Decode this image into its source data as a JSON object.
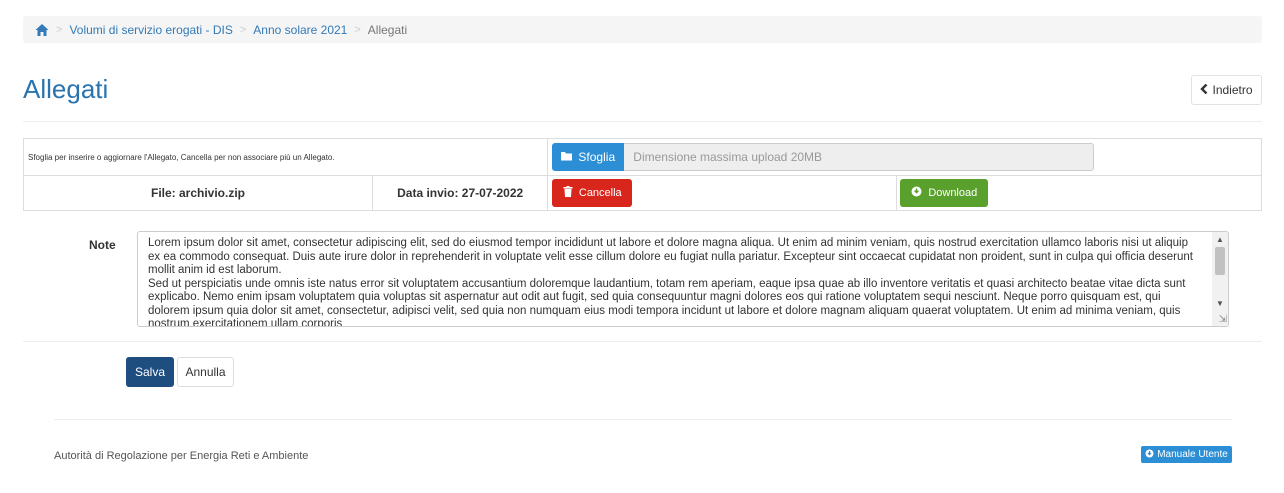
{
  "breadcrumb": {
    "home_icon": "home-icon",
    "items": [
      "Volumi di servizio erogati - DIS",
      "Anno solare 2021"
    ],
    "current": "Allegati"
  },
  "page": {
    "title": "Allegati",
    "back_label": "Indietro"
  },
  "attachment": {
    "hint": "Sfoglia per inserire o aggiornare l'Allegato, Cancella per non associare più un Allegato.",
    "browse_label": "Sfoglia",
    "upload_placeholder": "Dimensione massima upload 20MB",
    "file_label": "File: archivio.zip",
    "date_label": "Data invio: 27-07-2022",
    "delete_label": "Cancella",
    "download_label": "Download"
  },
  "note": {
    "label": "Note",
    "text": "Lorem ipsum dolor sit amet, consectetur adipiscing elit, sed do eiusmod tempor incididunt ut labore et dolore magna aliqua. Ut enim ad minim veniam, quis nostrud exercitation ullamco laboris nisi ut aliquip ex ea commodo consequat. Duis aute irure dolor in reprehenderit in voluptate velit esse cillum dolore eu fugiat nulla pariatur. Excepteur sint occaecat cupidatat non proident, sunt in culpa qui officia deserunt mollit anim id est laborum.\nSed ut perspiciatis unde omnis iste natus error sit voluptatem accusantium doloremque laudantium, totam rem aperiam, eaque ipsa quae ab illo inventore veritatis et quasi architecto beatae vitae dicta sunt explicabo. Nemo enim ipsam voluptatem quia voluptas sit aspernatur aut odit aut fugit, sed quia consequuntur magni dolores eos qui ratione voluptatem sequi nesciunt. Neque porro quisquam est, qui dolorem ipsum quia dolor sit amet, consectetur, adipisci velit, sed quia non numquam eius modi tempora incidunt ut labore et dolore magnam aliquam quaerat voluptatem. Ut enim ad minima veniam, quis nostrum exercitationem ullam corporis"
  },
  "actions": {
    "save_label": "Salva",
    "cancel_label": "Annulla"
  },
  "footer": {
    "text": "Autorità di Regolazione per Energia Reti e Ambiente",
    "manual_label": "Manuale Utente"
  },
  "colors": {
    "link": "#337ab7",
    "title": "#2a73ad",
    "primary": "#2c8fd6",
    "danger": "#d9261c",
    "success": "#5aa02c",
    "save": "#1e4d80"
  }
}
